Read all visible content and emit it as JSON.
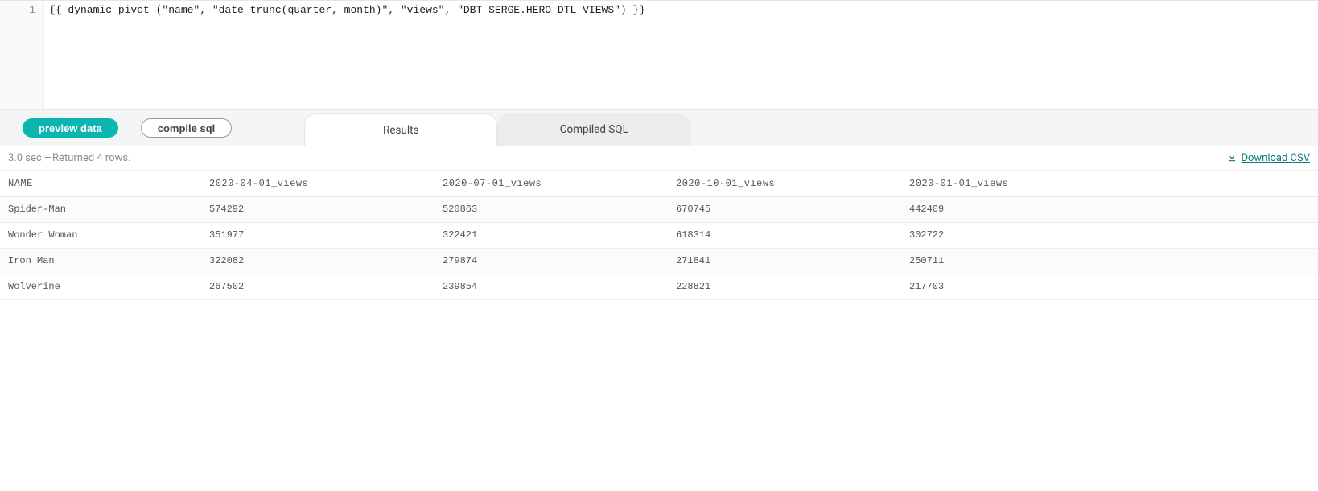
{
  "editor": {
    "line_number": "1",
    "code": "{{ dynamic_pivot (\"name\", \"date_trunc(quarter, month)\", \"views\", \"DBT_SERGE.HERO_DTL_VIEWS\") }}"
  },
  "toolbar": {
    "preview_label": "preview data",
    "compile_label": "compile sql"
  },
  "tabs": {
    "results": "Results",
    "compiled": "Compiled SQL"
  },
  "status": {
    "text": "3.0 sec  —Returned 4 rows.",
    "download": "Download CSV"
  },
  "table": {
    "columns": [
      "NAME",
      "2020-04-01_views",
      "2020-07-01_views",
      "2020-10-01_views",
      "2020-01-01_views"
    ],
    "rows": [
      [
        "Spider-Man",
        "574292",
        "520863",
        "670745",
        "442409"
      ],
      [
        "Wonder Woman",
        "351977",
        "322421",
        "618314",
        "302722"
      ],
      [
        "Iron Man",
        "322082",
        "279874",
        "271841",
        "250711"
      ],
      [
        "Wolverine",
        "267502",
        "239854",
        "228821",
        "217703"
      ]
    ]
  }
}
